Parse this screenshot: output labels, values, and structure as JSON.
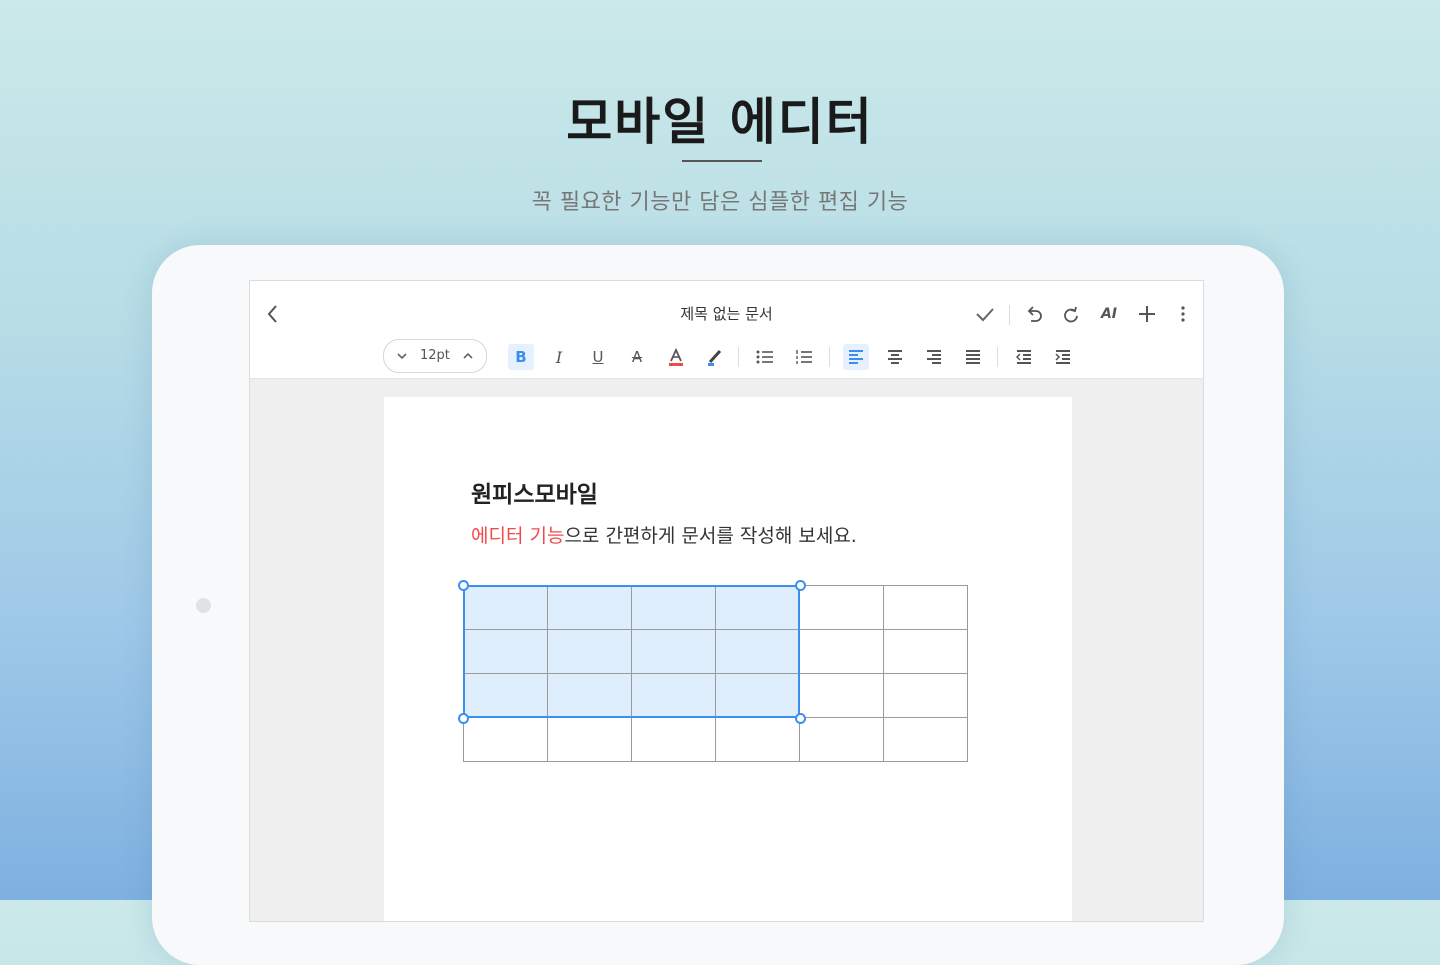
{
  "hero": {
    "title": "모바일 에디터",
    "subtitle": "꼭 필요한 기능만 담은 심플한 편집 기능"
  },
  "editor": {
    "document_title": "제목 없는 문서",
    "top_actions": [
      {
        "name": "check-icon"
      },
      {
        "name": "undo-icon"
      },
      {
        "name": "redo-icon"
      },
      {
        "name": "ai-icon",
        "label": "AI"
      },
      {
        "name": "plus-icon"
      },
      {
        "name": "more-vertical-icon"
      }
    ],
    "toolbar": {
      "font_size": "12pt",
      "buttons": [
        {
          "name": "bold-icon",
          "active": true
        },
        {
          "name": "italic-icon"
        },
        {
          "name": "underline-icon"
        },
        {
          "name": "strikethrough-icon"
        },
        {
          "name": "font-color-icon"
        },
        {
          "name": "highlight-icon"
        },
        {
          "name": "bullet-list-icon"
        },
        {
          "name": "numbered-list-icon"
        },
        {
          "name": "align-left-icon",
          "active": true
        },
        {
          "name": "align-center-icon"
        },
        {
          "name": "align-right-icon"
        },
        {
          "name": "align-justify-icon"
        },
        {
          "name": "indent-decrease-icon"
        },
        {
          "name": "indent-increase-icon"
        }
      ]
    }
  },
  "document": {
    "heading": "원피스모바일",
    "line_highlight": "에디터 기능",
    "line_rest": "으로 간편하게 문서를 작성해 보세요.",
    "table": {
      "rows": 4,
      "cols": 6,
      "selected_rows": 3,
      "selected_cols": 4
    }
  },
  "colors": {
    "accent": "#3a8ff0",
    "highlight_text": "#f04b4b",
    "selection_fill": "#dfeefd",
    "font_color_red": "#f04b4b"
  }
}
